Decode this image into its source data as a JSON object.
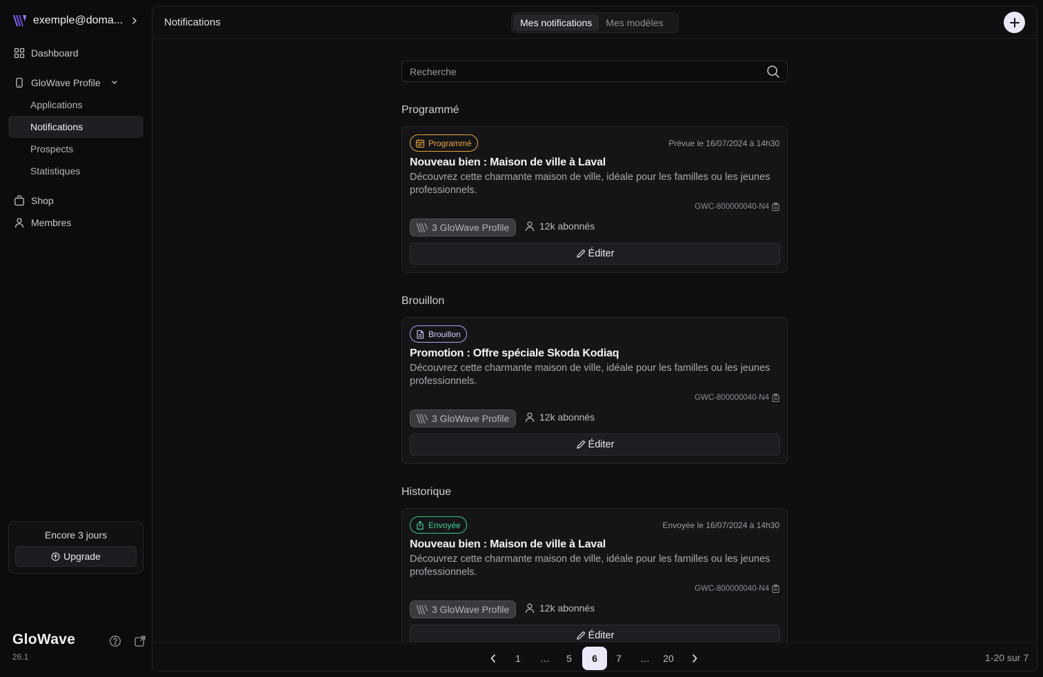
{
  "sidebar": {
    "account_email": "exemple@doma...",
    "items": [
      {
        "label": "Dashboard"
      },
      {
        "label": "GloWave Profile"
      },
      {
        "label": "Applications"
      },
      {
        "label": "Notifications"
      },
      {
        "label": "Prospects"
      },
      {
        "label": "Statistiques"
      },
      {
        "label": "Shop"
      },
      {
        "label": "Membres"
      }
    ],
    "trial_text": "Encore 3 jours",
    "upgrade_label": "Upgrade",
    "brand_name": "GloWave",
    "version": "26.1"
  },
  "topbar": {
    "title": "Notifications",
    "tabs": [
      {
        "label": "Mes notifications",
        "active": true
      },
      {
        "label": "Mes modèles",
        "active": false
      }
    ]
  },
  "search": {
    "placeholder": "Recherche"
  },
  "sections": [
    {
      "title": "Programmé",
      "card": {
        "badge": "Programmé",
        "date": "Prévue le 16/07/2024 à 14h30",
        "title": "Nouveau bien : Maison de ville à Laval",
        "description": "Découvrez cette charmante maison de ville, idéale pour les familles ou les jeunes professionnels.",
        "code": "GWC-800000040-N4",
        "chip": "3 GloWave Profile",
        "subscribers": "12k abonnés",
        "edit_label": "Éditer"
      }
    },
    {
      "title": "Brouillon",
      "card": {
        "badge": "Brouillon",
        "date": "",
        "title": "Promotion : Offre spéciale Skoda Kodiaq",
        "description": "Découvrez cette charmante maison de ville, idéale pour les familles ou les jeunes professionnels.",
        "code": "GWC-800000040-N4",
        "chip": "3 GloWave Profile",
        "subscribers": "12k abonnés",
        "edit_label": "Éditer"
      }
    },
    {
      "title": "Historique",
      "card": {
        "badge": "Envoyée",
        "date": "Envoyée le 16/07/2024 à 14h30",
        "title": "Nouveau bien : Maison de ville à Laval",
        "description": "Découvrez cette charmante maison de ville, idéale pour les familles ou les jeunes professionnels.",
        "code": "GWC-800000040-N4",
        "chip": "3 GloWave Profile",
        "subscribers": "12k abonnés",
        "edit_label": "Éditer"
      }
    }
  ],
  "pagination": {
    "pages": [
      "1",
      "…",
      "5",
      "6",
      "7",
      "…",
      "20"
    ],
    "current": "6",
    "range_text": "1-20 sur 7"
  },
  "colors": {
    "accent_logo": "#7c5cf5",
    "badge_scheduled": "#e9a43a",
    "badge_draft": "#b49ef0",
    "badge_sent": "#39c98a",
    "active_page": "#ece8f7"
  }
}
